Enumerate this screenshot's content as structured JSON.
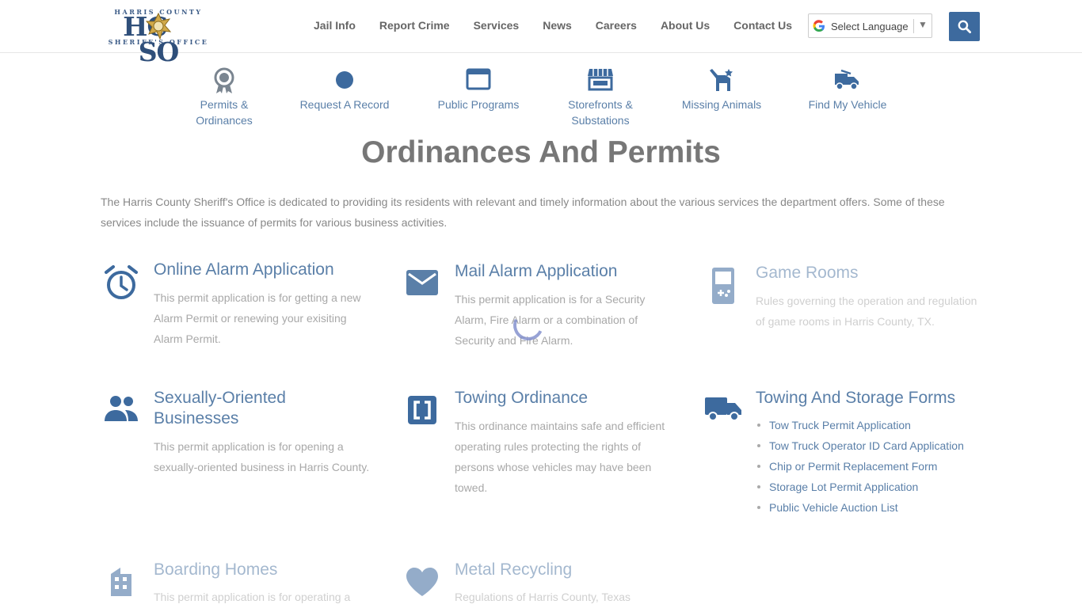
{
  "header": {
    "logo": {
      "top": "HARRIS COUNTY",
      "main": "HCSO",
      "bottom": "SHERIFF'S OFFICE"
    },
    "nav": [
      "Jail Info",
      "Report Crime",
      "Services",
      "News",
      "Careers",
      "About Us",
      "Contact Us"
    ],
    "language_select": "Select Language",
    "search_icon": "search-icon"
  },
  "quick_links": [
    {
      "label": "Permits & Ordinances",
      "icon": "award-icon"
    },
    {
      "label": "Request A Record",
      "icon": "circle-icon"
    },
    {
      "label": "Public Programs",
      "icon": "browser-window-icon"
    },
    {
      "label": "Storefronts & Substations",
      "icon": "storefront-icon"
    },
    {
      "label": "Missing Animals",
      "icon": "pet-icon"
    },
    {
      "label": "Find My Vehicle",
      "icon": "tow-truck-icon"
    }
  ],
  "page_title": "Ordinances And Permits",
  "intro": "The Harris County Sheriff's Office is dedicated to providing its residents with relevant and timely information about the various services the department offers. Some of these services include the issuance of permits for various business activities.",
  "cards": [
    {
      "title": "Online Alarm Application",
      "desc": "This permit application is for getting a new Alarm Permit or renewing your exisiting Alarm Permit.",
      "icon": "alarm-clock-icon"
    },
    {
      "title": "Mail Alarm Application",
      "desc": "This permit application is for a Security Alarm, Fire Alarm or a combination of Security and Fire Alarm.",
      "icon": "mail-icon"
    },
    {
      "title": "Game Rooms",
      "desc": "Rules governing the operation and regulation of game rooms in Harris County, TX.",
      "icon": "gameboy-icon"
    },
    {
      "title": "Sexually-Oriented Businesses",
      "desc": "This permit application is for opening a sexually-oriented business in Harris County.",
      "icon": "people-icon"
    },
    {
      "title": "Towing Ordinance",
      "desc": "This ordinance maintains safe and efficient operating rules protecting the rights of persons whose vehicles may have been towed.",
      "icon": "bracket-icon"
    },
    {
      "title": "Towing And Storage Forms",
      "links": [
        "Tow Truck Permit Application",
        "Tow Truck Operator ID Card Application",
        "Chip or Permit Replacement Form",
        "Storage Lot Permit Application",
        "Public Vehicle Auction List"
      ],
      "icon": "truck-icon"
    },
    {
      "title": "Boarding Homes",
      "desc": "This permit application is for operating a",
      "icon": "building-icon"
    },
    {
      "title": "Metal Recycling",
      "desc": "Regulations of Harris County, Texas",
      "icon": "heart-icon"
    }
  ],
  "colors": {
    "accent": "#5a7fa8",
    "search_button": "#3d6a9e",
    "title": "#777777"
  }
}
